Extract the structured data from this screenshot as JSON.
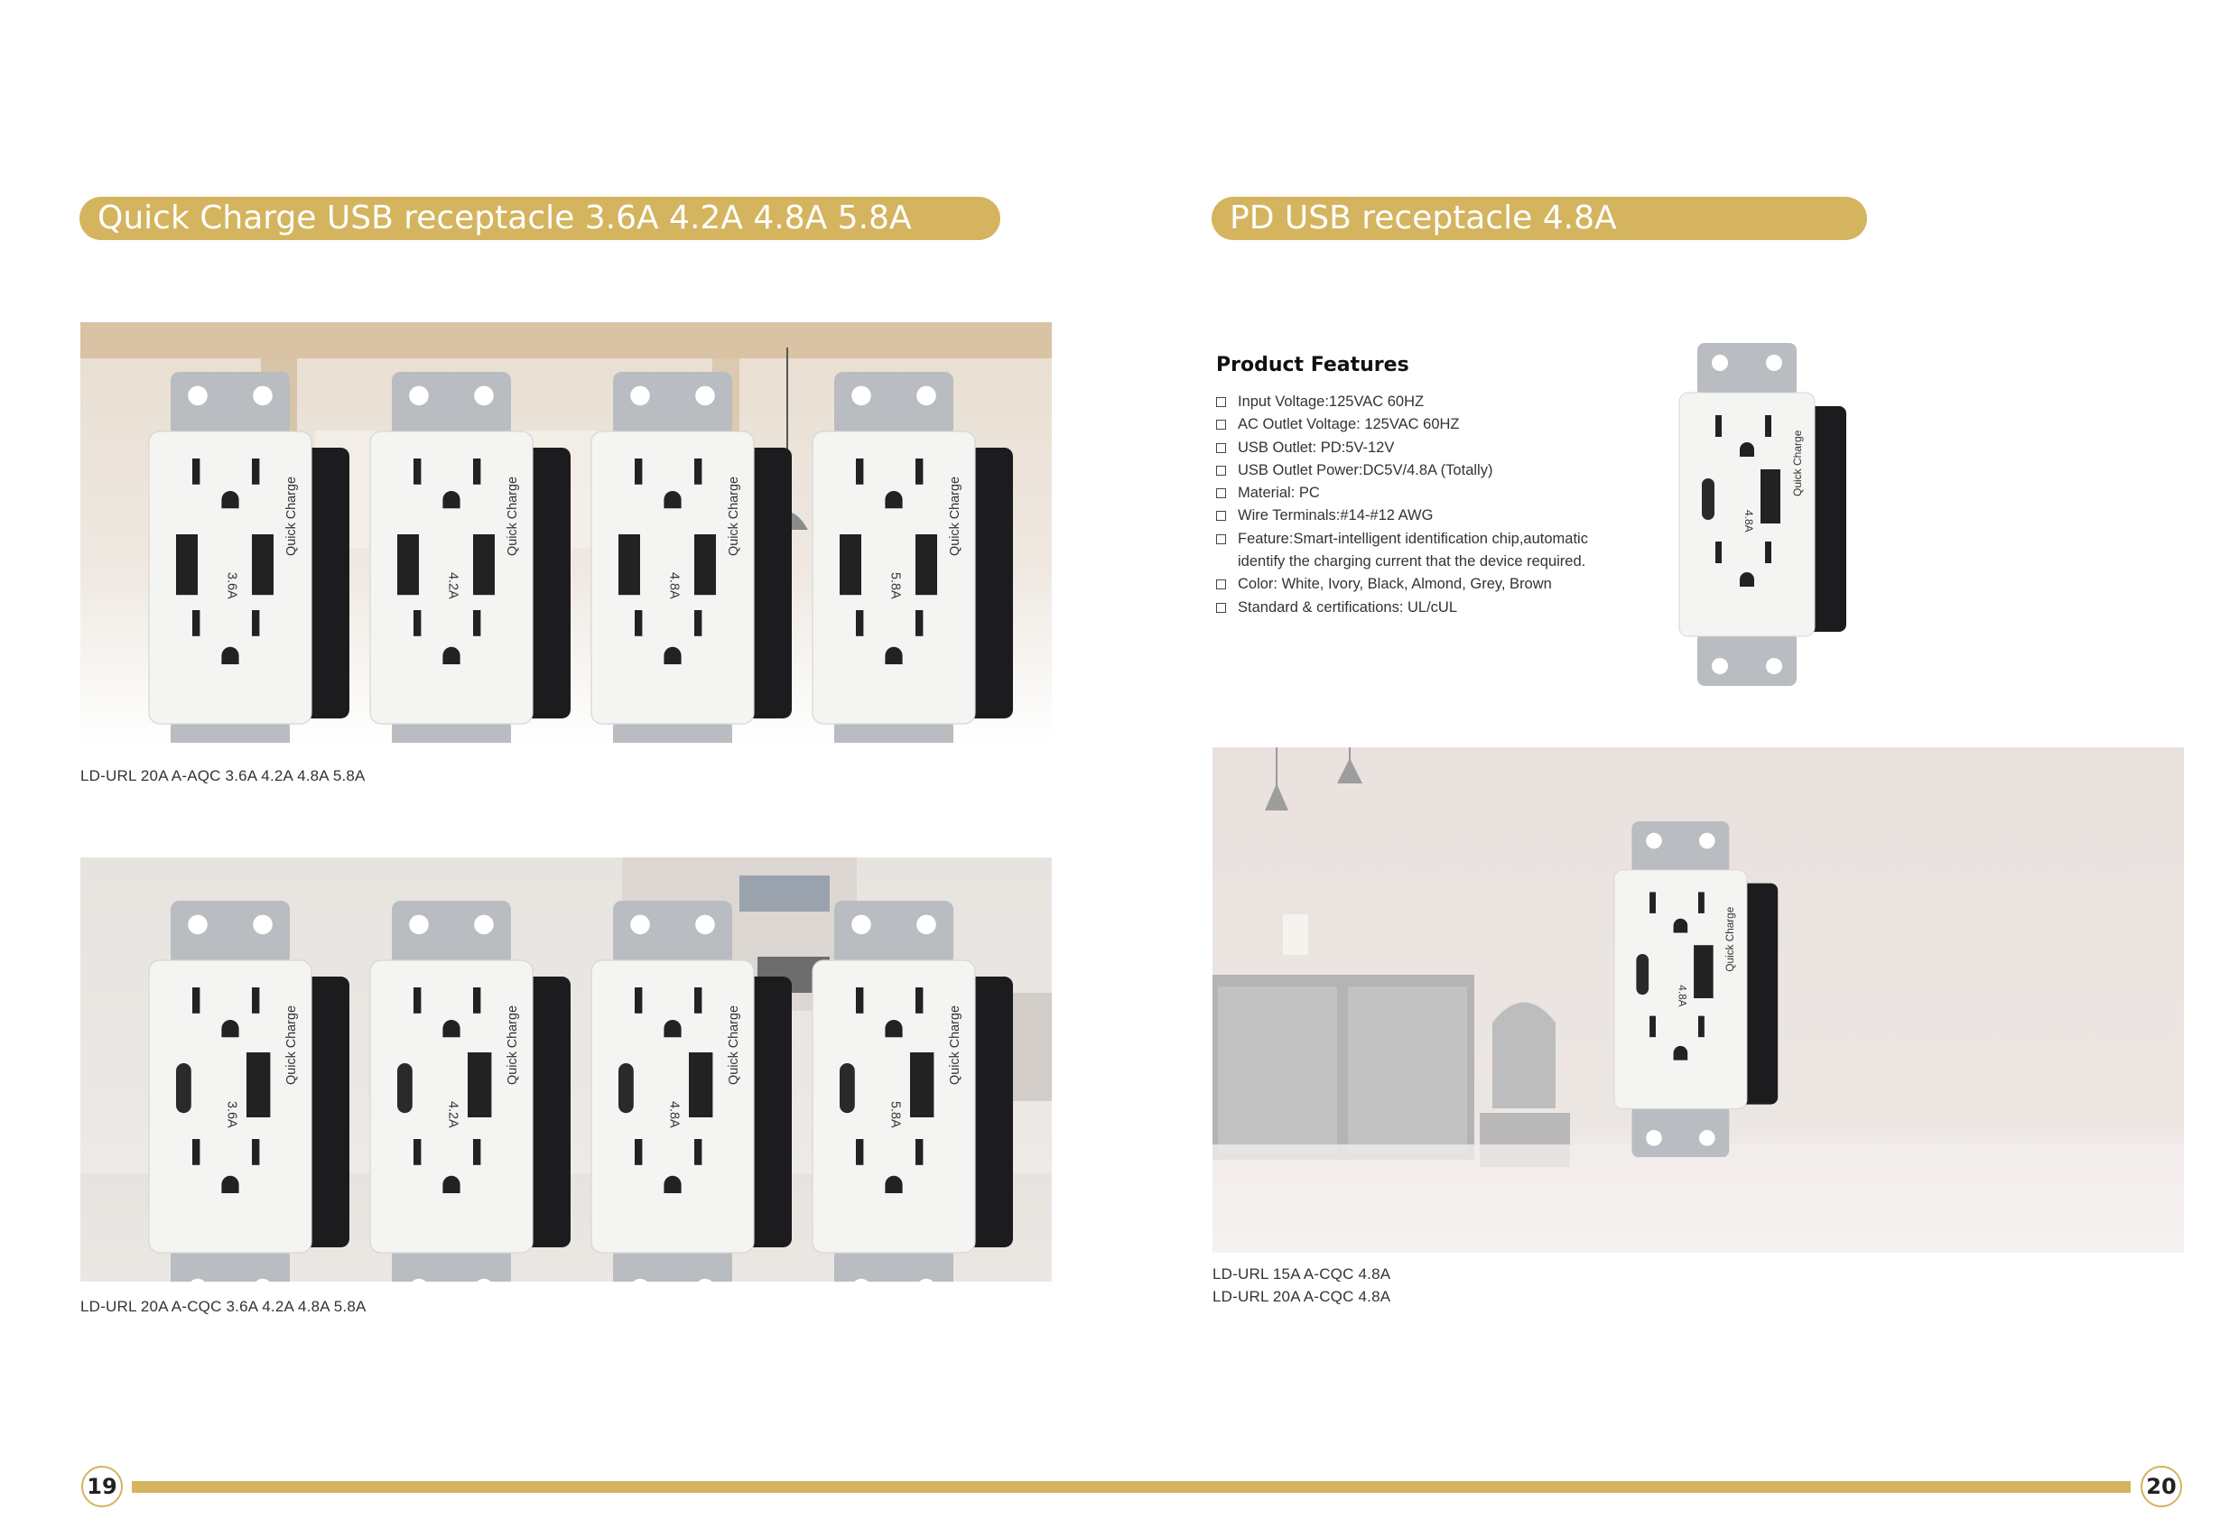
{
  "left_page": {
    "heading": "Quick Charge USB receptacle 3.6A 4.2A 4.8A 5.8A",
    "gallery_top": {
      "caption": "LD-URL  20A  A-AQC  3.6A 4.2A 4.8A 5.8A",
      "outlets": [
        {
          "rating": "3.6A",
          "brand": "Quick Charge"
        },
        {
          "rating": "4.2A",
          "brand": "Quick Charge"
        },
        {
          "rating": "4.8A",
          "brand": "Quick Charge"
        },
        {
          "rating": "5.8A",
          "brand": "Quick Charge"
        }
      ]
    },
    "gallery_bottom": {
      "caption": "LD-URL  20A  A-CQC  3.6A 4.2A 4.8A 5.8A",
      "outlets": [
        {
          "rating": "3.6A",
          "brand": "Quick Charge"
        },
        {
          "rating": "4.2A",
          "brand": "Quick Charge"
        },
        {
          "rating": "4.8A",
          "brand": "Quick Charge"
        },
        {
          "rating": "5.8A",
          "brand": "Quick Charge"
        }
      ]
    },
    "page_number": "19"
  },
  "right_page": {
    "heading": "PD USB receptacle  4.8A",
    "features_title": "Product Features",
    "features": [
      "Input Voltage:125VAC 60HZ",
      "AC Outlet Voltage: 125VAC 60HZ",
      "USB Outlet: PD:5V-12V",
      "USB Outlet Power:DC5V/4.8A (Totally)",
      "Material: PC",
      "Wire Terminals:#14-#12 AWG",
      "Feature:Smart-intelligent identification chip,automatic identify the charging current that the device required.",
      "Color: White, Ivory, Black, Almond, Grey, Brown",
      "Standard & certifications: UL/cUL"
    ],
    "captions": [
      "LD-URL  15A  A-CQC  4.8A",
      "LD-URL  20A  A-CQC  4.8A"
    ],
    "outlet": {
      "rating": "4.8A",
      "brand": "Quick Charge"
    },
    "page_number": "20"
  },
  "colors": {
    "accent_gold": "#d4b45e",
    "outlet_white": "#f4f4f2",
    "outlet_body": "#1c1c1e",
    "strap_metal": "#b9bcc0"
  }
}
